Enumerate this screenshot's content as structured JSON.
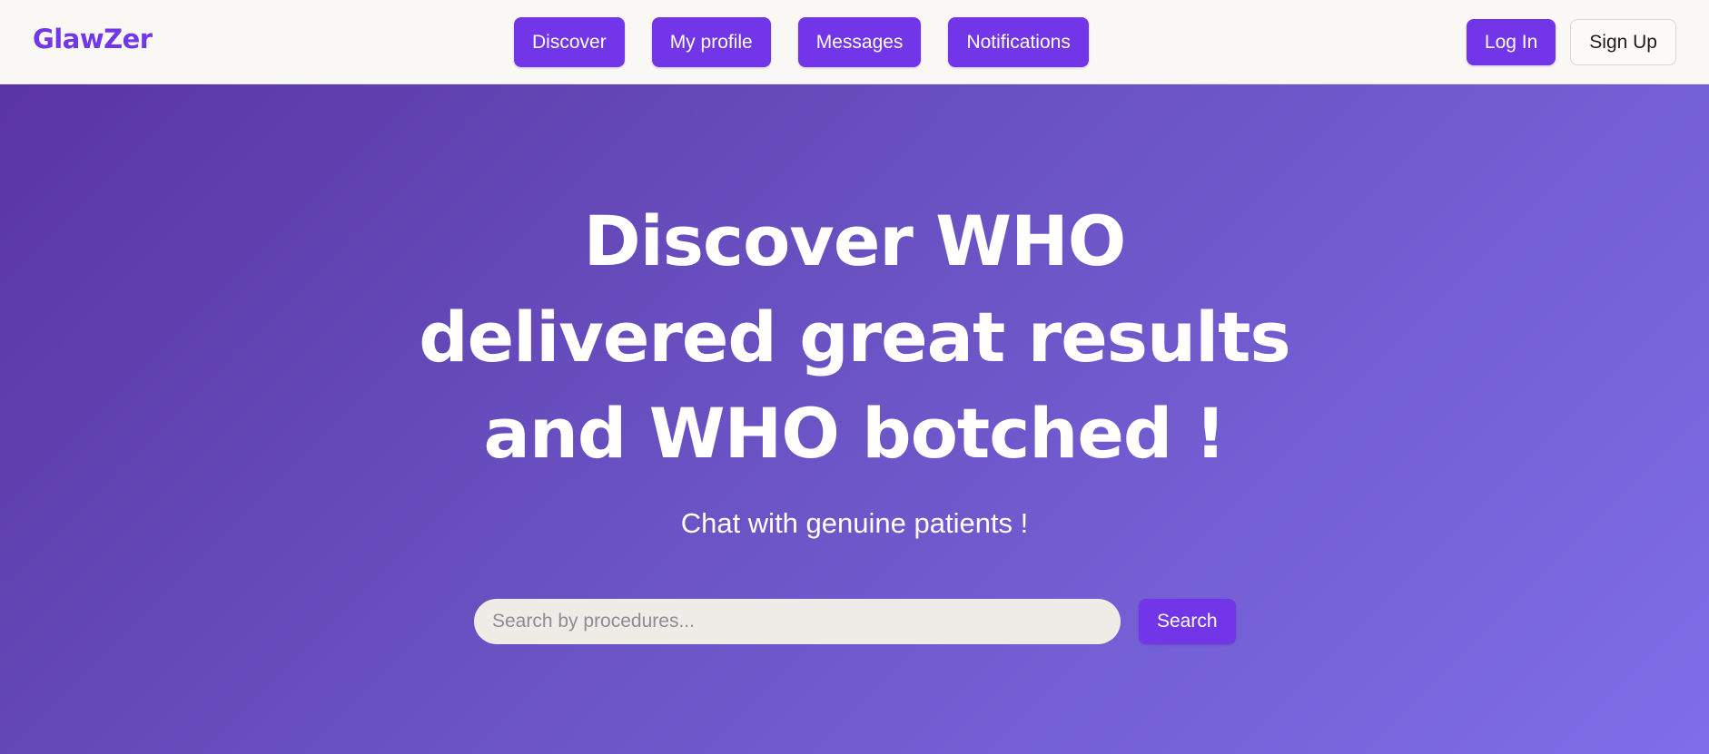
{
  "brand": {
    "name": "GlawZer",
    "color": "#7237e6"
  },
  "nav": {
    "items": [
      {
        "label": "Discover"
      },
      {
        "label": "My profile"
      },
      {
        "label": "Messages"
      },
      {
        "label": "Notifications"
      }
    ],
    "login_label": "Log In",
    "signup_label": "Sign Up"
  },
  "hero": {
    "title": "Discover WHO delivered great results and WHO botched !",
    "subtitle": "Chat with genuine patients !",
    "search": {
      "placeholder": "Search by procedures...",
      "value": "",
      "button_label": "Search"
    }
  },
  "colors": {
    "accent": "#7236e8",
    "hero_gradient_start": "#5a35a3",
    "hero_gradient_end": "#7f6ee8"
  },
  "icons": []
}
